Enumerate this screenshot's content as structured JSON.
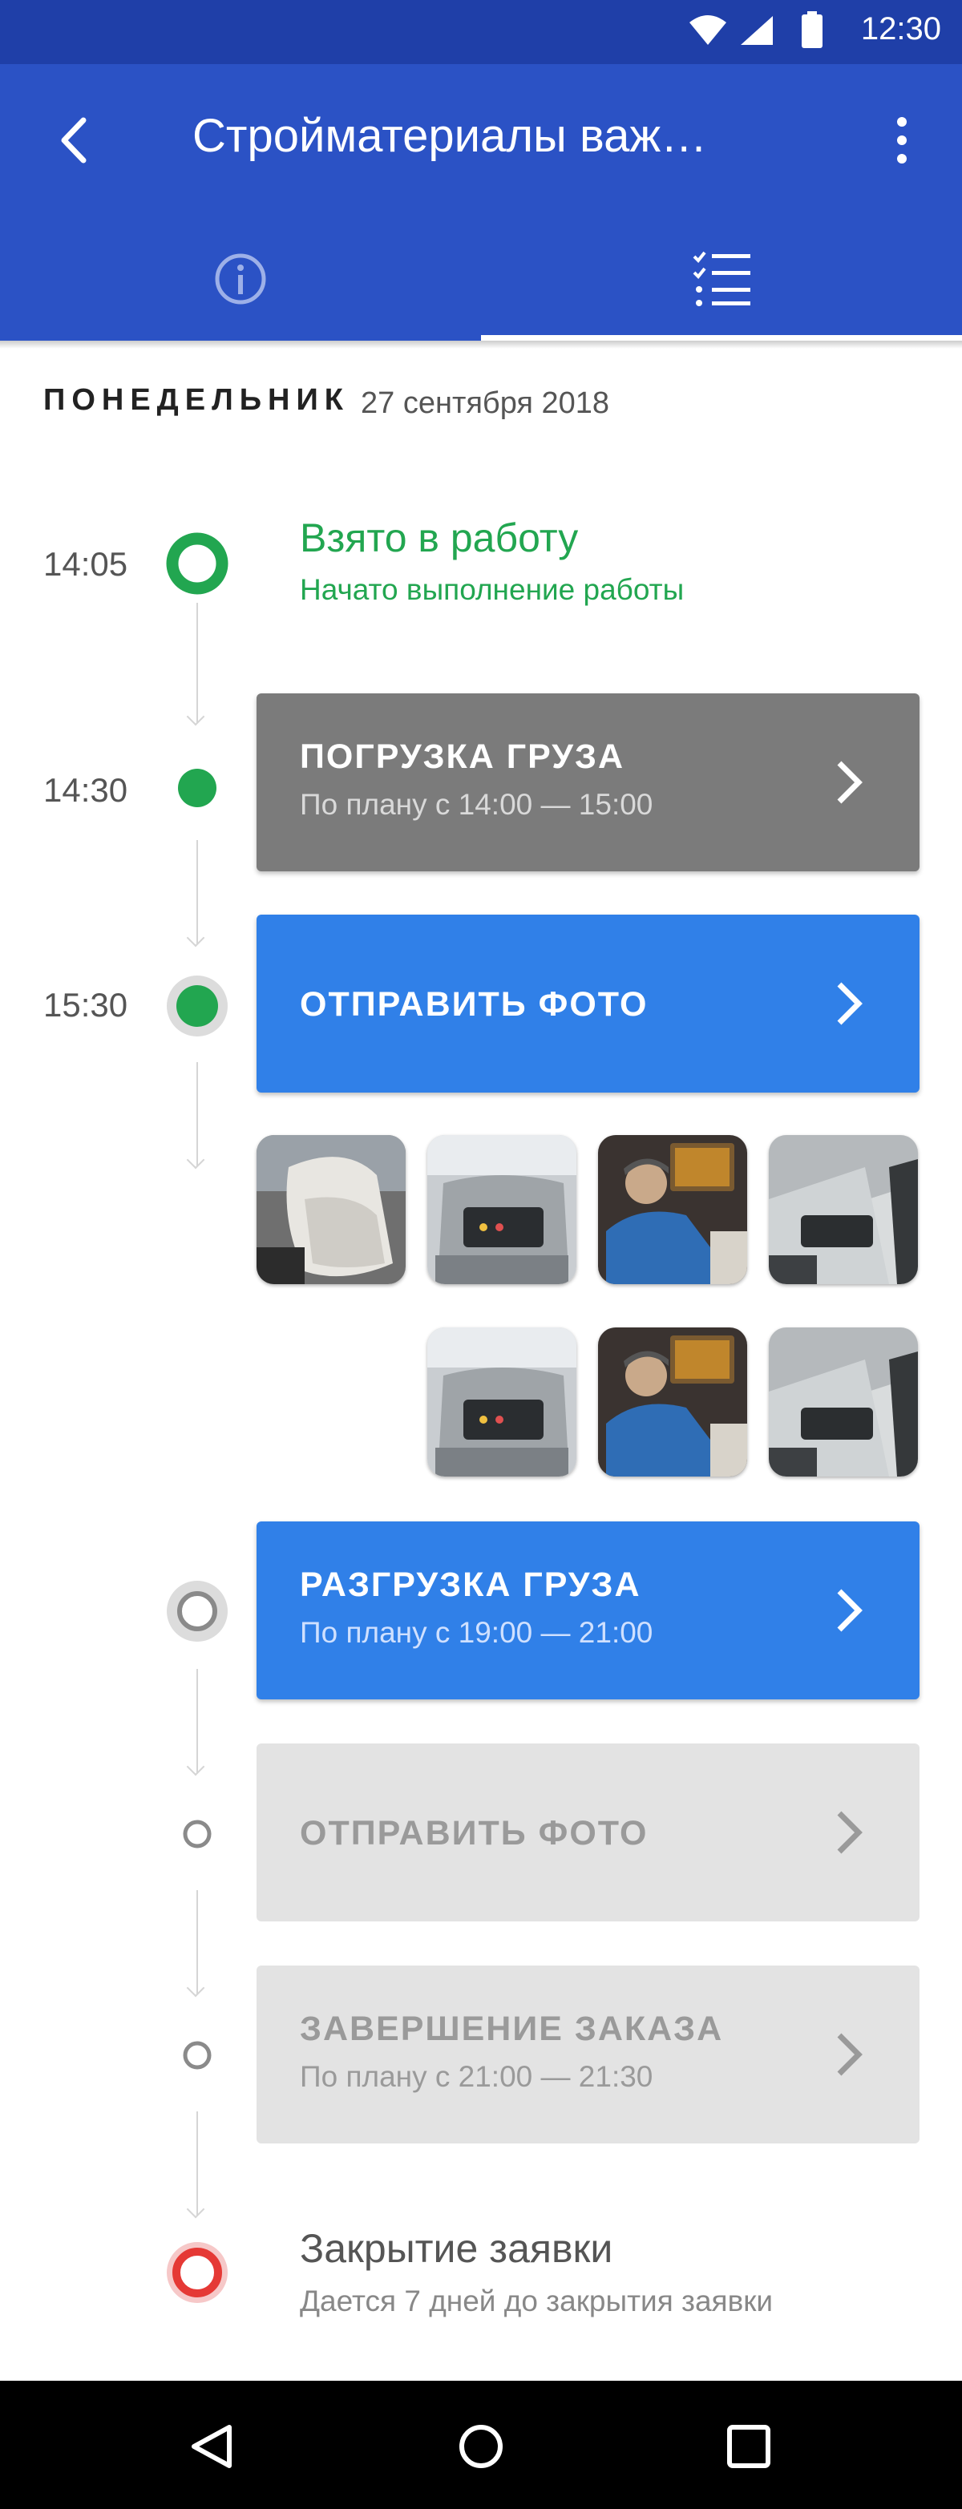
{
  "status_bar": {
    "time": "12:30"
  },
  "app_bar": {
    "title": "Стройматериалы важ…"
  },
  "tabs": [
    {
      "icon": "info-icon",
      "active": false
    },
    {
      "icon": "checklist-icon",
      "active": true
    }
  ],
  "date": {
    "day": "ПОНЕДЕЛЬНИК",
    "full": "27 сентября 2018"
  },
  "timeline": {
    "event1": {
      "time": "14:05",
      "title": "Взято в работу",
      "subtitle": "Начато выполнение работы"
    },
    "event2": {
      "time": "14:30",
      "title": "ПОГРУЗКА ГРУЗА",
      "subtitle": "По плану с 14:00 — 15:00"
    },
    "event3": {
      "time": "15:30",
      "title": "ОТПРАВИТЬ ФОТО"
    },
    "event4": {
      "title": "РАЗГРУЗКА ГРУЗА",
      "subtitle": "По плану с 19:00 — 21:00"
    },
    "event5": {
      "title": "ОТПРАВИТЬ ФОТО"
    },
    "event6": {
      "title": "ЗАВЕРШЕНИЕ ЗАКАЗА",
      "subtitle": "По плану с 21:00 — 21:30"
    },
    "event7": {
      "title": "Закрытие заявки",
      "subtitle": "Дается 7 дней до закрытия заявки"
    }
  },
  "colors": {
    "primary": "#2b52c5",
    "status_bar": "#1f3fa8",
    "accent_blue": "#3080e8",
    "done_green": "#22a650",
    "pending_grey": "#7b7b7b",
    "disabled": "#e3e3e3",
    "close_red": "#e53935"
  },
  "photos_count": 7
}
